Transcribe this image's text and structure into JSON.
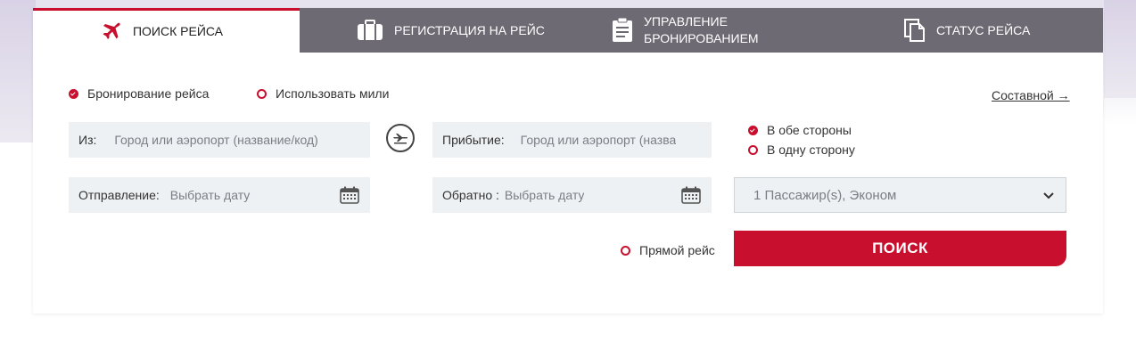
{
  "tabs": {
    "search": "ПОИСК РЕЙСА",
    "checkin": "РЕГИСТРАЦИЯ НА РЕЙС",
    "manage": "УПРАВЛЕНИЕ\nБРОНИРОВАНИЕМ",
    "status": "СТАТУС РЕЙСА"
  },
  "booking_type": {
    "booking": "Бронирование рейса",
    "miles": "Использовать мили",
    "selected": "booking"
  },
  "composite_link": "Составной →",
  "from": {
    "label": "Из:",
    "placeholder": "Город или аэропорт (название/код)"
  },
  "to": {
    "label": "Прибытие:",
    "placeholder": "Город или аэропорт (назва"
  },
  "trip_type": {
    "roundtrip": "В обе стороны",
    "oneway": "В одну сторону",
    "selected": "roundtrip"
  },
  "departure": {
    "label": "Отправление:",
    "placeholder": "Выбрать дату"
  },
  "return": {
    "label": "Обратно :",
    "placeholder": "Выбрать дату"
  },
  "passengers": "1 Пассажир(s), Эконом",
  "direct_flight": "Прямой рейс",
  "search_button": "ПОИСК",
  "colors": {
    "accent": "#c8102e",
    "tab_bar": "#6d6a73",
    "field_bg": "#eef1f4"
  },
  "icons": {
    "search_tab": "airplane-icon",
    "checkin_tab": "suitcase-icon",
    "manage_tab": "clipboard-icon",
    "status_tab": "documents-icon",
    "swap": "swap-direction-icon",
    "calendar": "calendar-icon",
    "dropdown": "chevron-down-icon"
  }
}
